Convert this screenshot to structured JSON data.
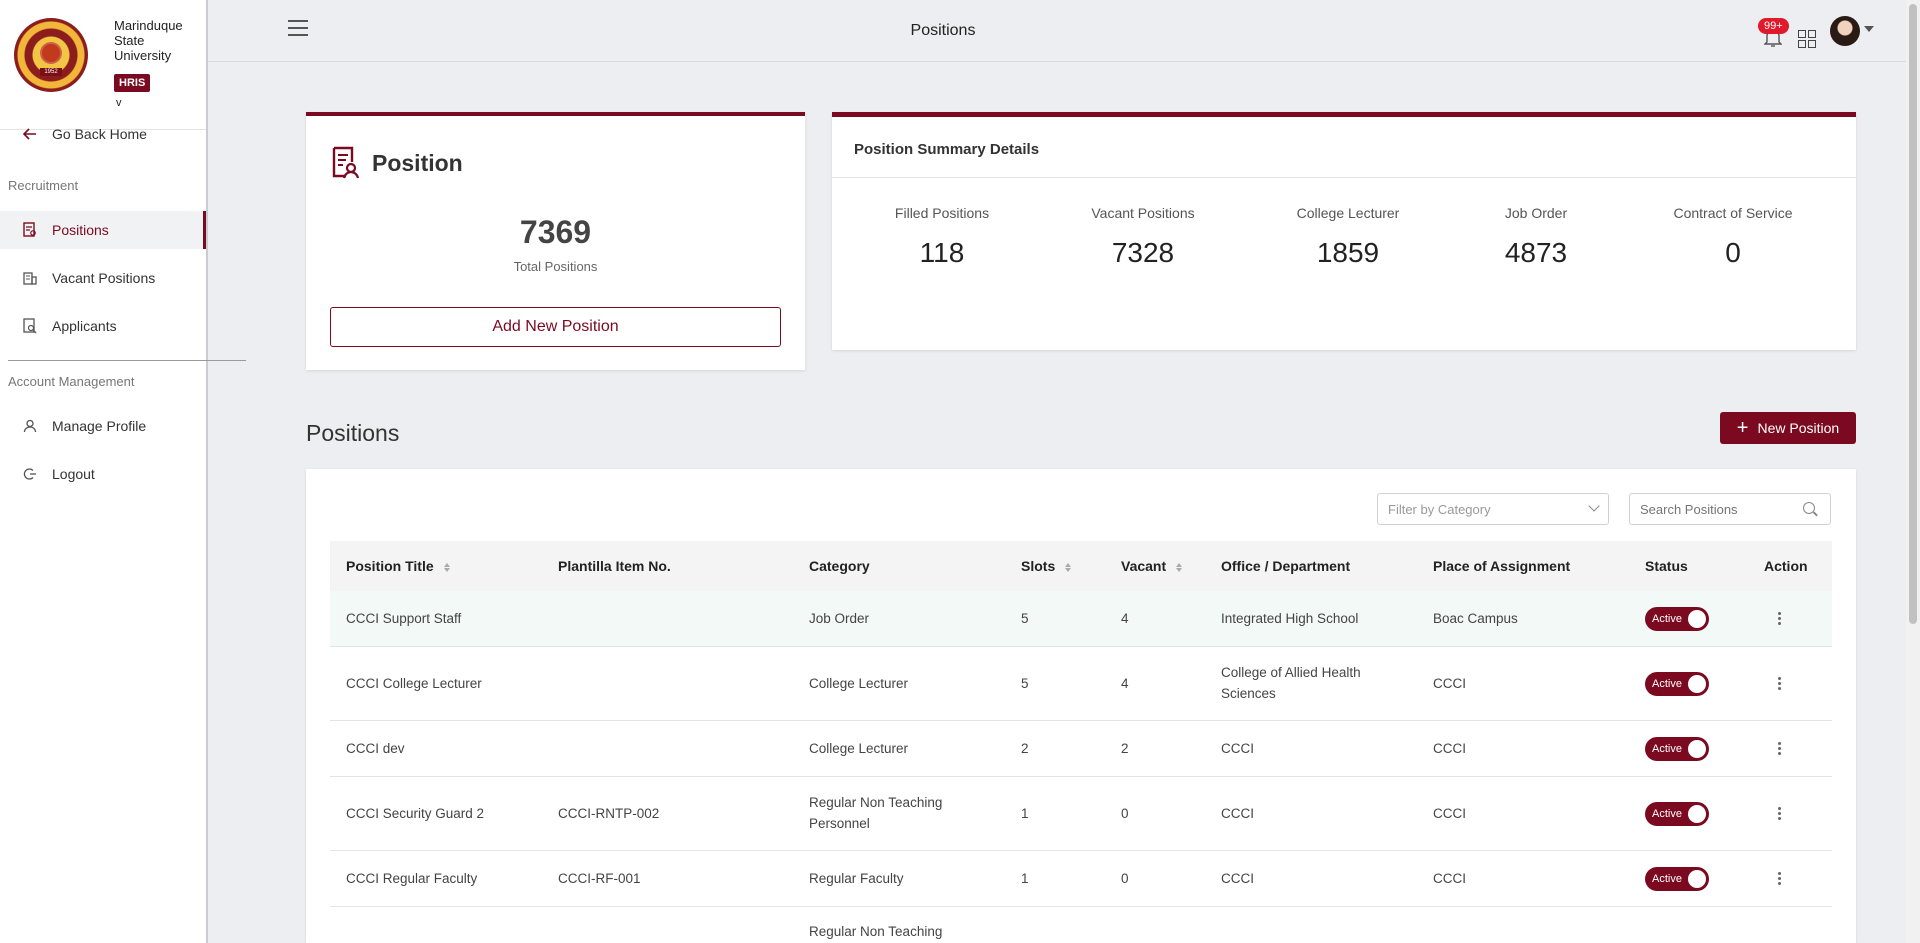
{
  "brand": {
    "name": "Marinduque State University",
    "badge": "HRIS",
    "version": "v",
    "logo_year": "1952"
  },
  "sidebar": {
    "go_back": "Go Back Home",
    "section_recruitment": "Recruitment",
    "items": [
      {
        "label": "Positions",
        "icon": "document-user-icon",
        "active": true
      },
      {
        "label": "Vacant Positions",
        "icon": "building-icon",
        "active": false
      },
      {
        "label": "Applicants",
        "icon": "search-document-icon",
        "active": false
      }
    ],
    "section_account": "Account Management",
    "account_items": [
      {
        "label": "Manage Profile",
        "icon": "user-icon"
      },
      {
        "label": "Logout",
        "icon": "logout-icon"
      }
    ]
  },
  "topbar": {
    "title": "Positions",
    "notifications": "99+"
  },
  "position_card": {
    "title": "Position",
    "total": "7369",
    "total_label": "Total Positions",
    "add_button": "Add New Position"
  },
  "summary": {
    "title": "Position Summary Details",
    "items": [
      {
        "label": "Filled Positions",
        "value": "118"
      },
      {
        "label": "Vacant Positions",
        "value": "7328"
      },
      {
        "label": "College Lecturer",
        "value": "1859"
      },
      {
        "label": "Job Order",
        "value": "4873"
      },
      {
        "label": "Contract of Service",
        "value": "0"
      }
    ]
  },
  "positions_section": {
    "heading": "Positions",
    "new_button": "New Position",
    "filter_placeholder": "Filter by Category",
    "search_placeholder": "Search Positions"
  },
  "table": {
    "columns": [
      "Position Title",
      "Plantilla Item No.",
      "Category",
      "Slots",
      "Vacant",
      "Office / Department",
      "Place of Assignment",
      "Status",
      "Action"
    ],
    "rows": [
      {
        "title": "CCCI Support Staff",
        "plantilla": "",
        "category": "Job Order",
        "slots": "5",
        "vacant": "4",
        "office": "Integrated High School",
        "place": "Boac Campus",
        "status": "Active"
      },
      {
        "title": "CCCI College Lecturer",
        "plantilla": "",
        "category": "College Lecturer",
        "slots": "5",
        "vacant": "4",
        "office": "College of Allied Health Sciences",
        "place": "CCCI",
        "status": "Active"
      },
      {
        "title": "CCCI dev",
        "plantilla": "",
        "category": "College Lecturer",
        "slots": "2",
        "vacant": "2",
        "office": "CCCI",
        "place": "CCCI",
        "status": "Active"
      },
      {
        "title": "CCCI Security Guard 2",
        "plantilla": "CCCI-RNTP-002",
        "category": "Regular Non Teaching Personnel",
        "slots": "1",
        "vacant": "0",
        "office": "CCCI",
        "place": "CCCI",
        "status": "Active"
      },
      {
        "title": "CCCI Regular Faculty",
        "plantilla": "CCCI-RF-001",
        "category": "Regular Faculty",
        "slots": "1",
        "vacant": "0",
        "office": "CCCI",
        "place": "CCCI",
        "status": "Active"
      },
      {
        "title": "",
        "plantilla": "",
        "category": "Regular Non Teaching",
        "slots": "",
        "vacant": "",
        "office": "",
        "place": "",
        "status": ""
      }
    ]
  },
  "colors": {
    "accent": "#7b0a20",
    "badge": "#e0192b",
    "row_highlight": "#f2f9f7"
  }
}
